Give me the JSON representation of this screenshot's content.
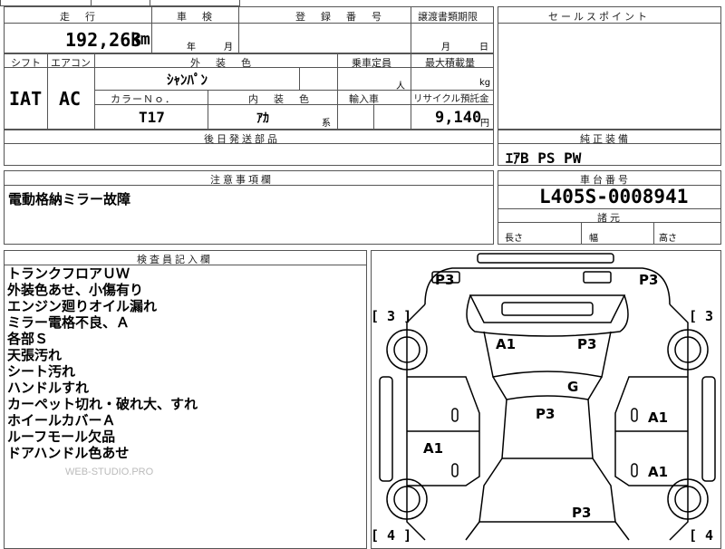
{
  "top": {
    "headers": {
      "mileage": "走　行",
      "inspection": "車　検",
      "registration": "登　録　番　号",
      "transfer_deadline": "譲渡書類期限",
      "sales_point": "セールスポイント"
    },
    "mileage_value": "192,263",
    "mileage_unit": "km",
    "inspection_year": "年",
    "inspection_month": "月",
    "deadline_month": "月",
    "deadline_day": "日"
  },
  "row2": {
    "headers": {
      "shift": "シフト",
      "aircon": "エアコン",
      "exterior_color": "外　装　色",
      "capacity": "乗車定員",
      "max_load": "最大積載量",
      "color_no": "カラーＮｏ．",
      "interior_color": "内　装　色",
      "import": "輸入車",
      "recycle": "リサイクル預託金"
    },
    "shift_value": "IAT",
    "aircon_value": "AC",
    "exterior_color_value": "ｼｬﾝﾊﾟﾝ",
    "capacity_unit": "人",
    "load_unit": "kg",
    "color_no_value": "T17",
    "interior_color_value": "ｱｶ",
    "interior_suffix": "系",
    "recycle_value": "9,140",
    "recycle_unit": "円"
  },
  "later_parts_header": "後日発送部品",
  "genuine_equipment": {
    "header": "純正装備",
    "value": "ｴｱB PS PW"
  },
  "caution": {
    "header": "注意事項欄",
    "value": "電動格納ミラー故障"
  },
  "chassis": {
    "header": "車台番号",
    "value": "L405S-0008941",
    "dimensions_header": "諸元",
    "length_label": "長さ",
    "width_label": "幅",
    "height_label": "高さ"
  },
  "inspector": {
    "header": "検査員記入欄",
    "lines": [
      "トランクフロアＵＷ",
      "外装色あせ、小傷有り",
      "エンジン廻りオイル漏れ",
      "ミラー電格不良、Ａ",
      "各部Ｓ",
      "天張汚れ",
      "シート汚れ",
      "ハンドルすれ",
      "カーペット切れ・破れ大、すれ",
      "ホイールカバーＡ",
      "ルーフモール欠品",
      "ドアハンドル色あせ"
    ],
    "watermark": "WEB-STUDIO.PRO"
  },
  "car_sheet": {
    "labels": {
      "rear_left": "P3",
      "rear_right": "P3",
      "trunk_left": "A1",
      "trunk_right": "P3",
      "rear_glass": "G",
      "roof": "P3",
      "left_rear_door": "A1",
      "right_rear_door": "A1",
      "right_front_door": "A1",
      "hood": "P3"
    },
    "brackets": {
      "top_left": "[ 3 ]",
      "top_right": "[ 3",
      "bottom_left": "[ 4 ]",
      "bottom_right": "[ 4"
    }
  }
}
